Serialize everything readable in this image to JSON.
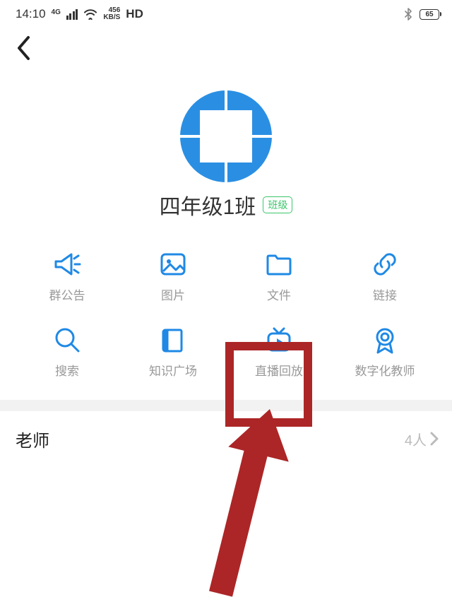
{
  "status": {
    "time": "14:10",
    "net_label_top": "456",
    "net_label_bottom": "KB/S",
    "hd": "HD",
    "battery": "65",
    "net_gen": "4G"
  },
  "group": {
    "name": "四年级1班",
    "badge": "班级"
  },
  "grid": [
    {
      "label": "群公告"
    },
    {
      "label": "图片"
    },
    {
      "label": "文件"
    },
    {
      "label": "链接"
    },
    {
      "label": "搜索"
    },
    {
      "label": "知识广场"
    },
    {
      "label": "直播回放"
    },
    {
      "label": "数字化教师"
    }
  ],
  "teacher": {
    "label": "老师",
    "count": "4人"
  },
  "accent": "#1f89e5"
}
